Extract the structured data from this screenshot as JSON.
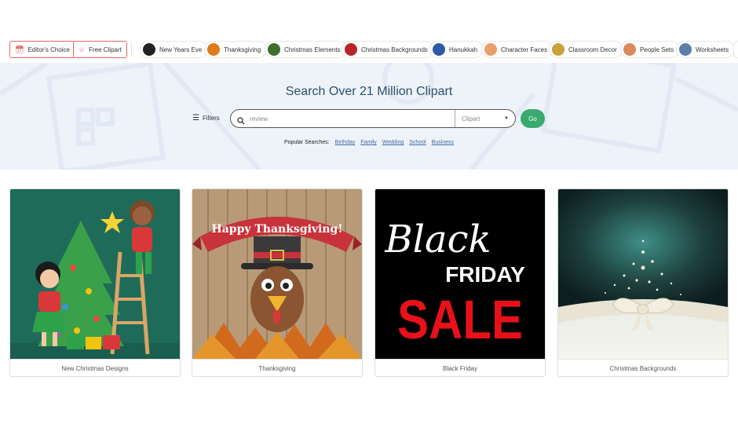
{
  "topbar": {
    "editors_choice": "Editor's Choice",
    "free_clipart": "Free Clipart",
    "categories": [
      {
        "label": "New Years Eve",
        "color": "#222222"
      },
      {
        "label": "Thanksgiving",
        "color": "#e07b1a"
      },
      {
        "label": "Christmas Elements",
        "color": "#3f6f2a"
      },
      {
        "label": "Christmas Backgrounds",
        "color": "#b8242c"
      },
      {
        "label": "Hanukkah",
        "color": "#2d5aa8"
      },
      {
        "label": "Character Faces",
        "color": "#e8a06b"
      },
      {
        "label": "Classroom Decor",
        "color": "#c9a23a"
      },
      {
        "label": "People Sets",
        "color": "#d88a5a"
      },
      {
        "label": "Worksheets",
        "color": "#5b7fa6"
      }
    ]
  },
  "hero": {
    "title": "Search Over 21 Million Clipart",
    "filters_label": "Filters",
    "search_value": "review",
    "select_value": "Clipart",
    "go_label": "Go",
    "popular_label": "Popular Searches:",
    "popular_links": [
      "Birthday",
      "Family",
      "Wedding",
      "School",
      "Business"
    ]
  },
  "cards": [
    {
      "caption": "New Christmas Designs"
    },
    {
      "caption": "Thanksgiving",
      "banner_text": "Happy Thanksgiving!"
    },
    {
      "caption": "Black Friday",
      "line1": "Black",
      "line2": "FRIDAY",
      "line3": "SALE"
    },
    {
      "caption": "Christmas Backgrounds"
    }
  ],
  "colors": {
    "accent_red": "#e06666",
    "go_green": "#3aaa6f",
    "title_blue": "#2c4f6d",
    "hero_bg": "#eef3fa"
  }
}
